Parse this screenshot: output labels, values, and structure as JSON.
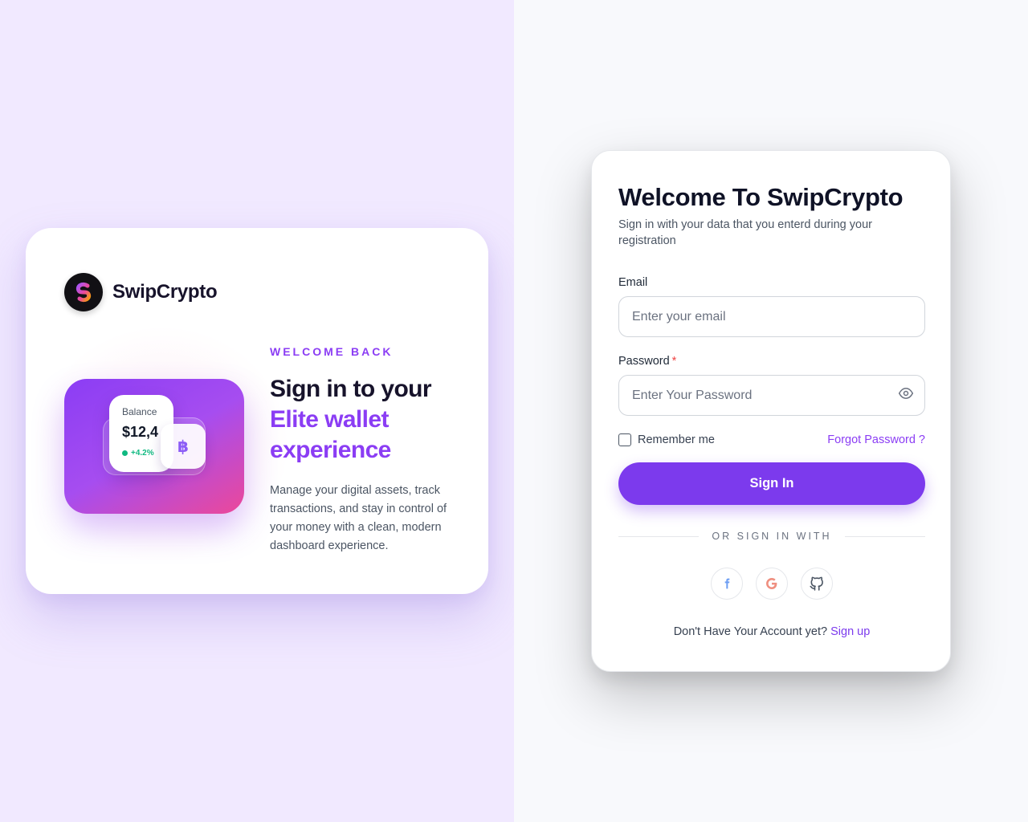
{
  "brand": {
    "name": "SwipCrypto"
  },
  "promo": {
    "eyebrow": "WELCOME BACK",
    "headline_line1": "Sign in to your",
    "headline_line2": "Elite wallet",
    "headline_line3": "experience",
    "description": "Manage your digital assets, track transactions, and stay in control of your money with a clean, modern dashboard experience.",
    "balance_label": "Balance",
    "balance_value": "$12,4",
    "balance_change": "+4.2%",
    "coin_symbol": "฿"
  },
  "login": {
    "title": "Welcome To SwipCrypto",
    "subtitle": "Sign in with your data that you enterd during your registration",
    "email_label": "Email",
    "email_placeholder": "Enter your email",
    "email_value": "",
    "password_label": "Password",
    "password_required_mark": "*",
    "password_placeholder": "Enter Your Password",
    "password_value": "",
    "remember_label": "Remember me",
    "remember_checked": false,
    "forgot_label": "Forgot Password ?",
    "signin_label": "Sign In",
    "divider_label": "OR SIGN IN WITH",
    "social_icons": [
      "facebook-icon",
      "google-icon",
      "github-icon"
    ],
    "no_account_text": "Don't Have Your Account yet?",
    "signup_label": "Sign up"
  },
  "colors": {
    "accent": "#7c3aed",
    "accent_text": "#8b3df4",
    "left_background": "#f1e9ff",
    "right_background": "#f8f9fc",
    "success": "#10b981",
    "required": "#ef4444"
  }
}
